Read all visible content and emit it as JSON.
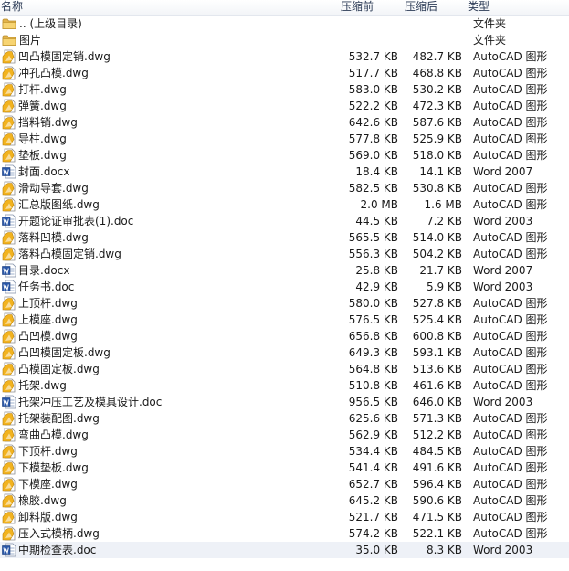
{
  "columns": {
    "name": "名称",
    "compressed": "压缩前",
    "original": "压缩后",
    "type": "类型"
  },
  "rows": [
    {
      "name": ".. (上级目录)",
      "compressed": "",
      "original": "",
      "type": "文件夹",
      "icon": "folder-icon"
    },
    {
      "name": "图片",
      "compressed": "",
      "original": "",
      "type": "文件夹",
      "icon": "folder-icon"
    },
    {
      "name": "凹凸模固定销.dwg",
      "compressed": "532.7 KB",
      "original": "482.7 KB",
      "type": "AutoCAD 图形",
      "icon": "dwg-file-icon"
    },
    {
      "name": "冲孔凸模.dwg",
      "compressed": "517.7 KB",
      "original": "468.8 KB",
      "type": "AutoCAD 图形",
      "icon": "dwg-file-icon"
    },
    {
      "name": "打杆.dwg",
      "compressed": "583.0 KB",
      "original": "530.2 KB",
      "type": "AutoCAD 图形",
      "icon": "dwg-file-icon"
    },
    {
      "name": "弹簧.dwg",
      "compressed": "522.2 KB",
      "original": "472.3 KB",
      "type": "AutoCAD 图形",
      "icon": "dwg-file-icon"
    },
    {
      "name": "挡料销.dwg",
      "compressed": "642.6 KB",
      "original": "587.6 KB",
      "type": "AutoCAD 图形",
      "icon": "dwg-file-icon"
    },
    {
      "name": "导柱.dwg",
      "compressed": "577.8 KB",
      "original": "525.9 KB",
      "type": "AutoCAD 图形",
      "icon": "dwg-file-icon"
    },
    {
      "name": "垫板.dwg",
      "compressed": "569.0 KB",
      "original": "518.0 KB",
      "type": "AutoCAD 图形",
      "icon": "dwg-file-icon"
    },
    {
      "name": "封面.docx",
      "compressed": "18.4 KB",
      "original": "14.1 KB",
      "type": "Word 2007",
      "icon": "word-file-icon"
    },
    {
      "name": "滑动导套.dwg",
      "compressed": "582.5 KB",
      "original": "530.8 KB",
      "type": "AutoCAD 图形",
      "icon": "dwg-file-icon"
    },
    {
      "name": "汇总版图纸.dwg",
      "compressed": "2.0 MB",
      "original": "1.6 MB",
      "type": "AutoCAD 图形",
      "icon": "dwg-file-icon"
    },
    {
      "name": "开题论证审批表(1).doc",
      "compressed": "44.5 KB",
      "original": "7.2 KB",
      "type": "Word 2003",
      "icon": "word-file-icon"
    },
    {
      "name": "落料凹模.dwg",
      "compressed": "565.5 KB",
      "original": "514.0 KB",
      "type": "AutoCAD 图形",
      "icon": "dwg-file-icon"
    },
    {
      "name": "落料凸模固定销.dwg",
      "compressed": "556.3 KB",
      "original": "504.2 KB",
      "type": "AutoCAD 图形",
      "icon": "dwg-file-icon"
    },
    {
      "name": "目录.docx",
      "compressed": "25.8 KB",
      "original": "21.7 KB",
      "type": "Word 2007",
      "icon": "word-file-icon"
    },
    {
      "name": "任务书.doc",
      "compressed": "42.9 KB",
      "original": "5.9 KB",
      "type": "Word 2003",
      "icon": "word-file-icon"
    },
    {
      "name": "上顶杆.dwg",
      "compressed": "580.0 KB",
      "original": "527.8 KB",
      "type": "AutoCAD 图形",
      "icon": "dwg-file-icon"
    },
    {
      "name": "上模座.dwg",
      "compressed": "576.5 KB",
      "original": "525.4 KB",
      "type": "AutoCAD 图形",
      "icon": "dwg-file-icon"
    },
    {
      "name": "凸凹模.dwg",
      "compressed": "656.8 KB",
      "original": "600.8 KB",
      "type": "AutoCAD 图形",
      "icon": "dwg-file-icon"
    },
    {
      "name": "凸凹模固定板.dwg",
      "compressed": "649.3 KB",
      "original": "593.1 KB",
      "type": "AutoCAD 图形",
      "icon": "dwg-file-icon"
    },
    {
      "name": "凸模固定板.dwg",
      "compressed": "564.8 KB",
      "original": "513.6 KB",
      "type": "AutoCAD 图形",
      "icon": "dwg-file-icon"
    },
    {
      "name": "托架.dwg",
      "compressed": "510.8 KB",
      "original": "461.6 KB",
      "type": "AutoCAD 图形",
      "icon": "dwg-file-icon"
    },
    {
      "name": "托架冲压工艺及模具设计.doc",
      "compressed": "956.5 KB",
      "original": "646.0 KB",
      "type": "Word 2003",
      "icon": "word-file-icon"
    },
    {
      "name": "托架装配图.dwg",
      "compressed": "625.6 KB",
      "original": "571.3 KB",
      "type": "AutoCAD 图形",
      "icon": "dwg-file-icon"
    },
    {
      "name": "弯曲凸模.dwg",
      "compressed": "562.9 KB",
      "original": "512.2 KB",
      "type": "AutoCAD 图形",
      "icon": "dwg-file-icon"
    },
    {
      "name": "下顶杆.dwg",
      "compressed": "534.4 KB",
      "original": "484.5 KB",
      "type": "AutoCAD 图形",
      "icon": "dwg-file-icon"
    },
    {
      "name": "下模垫板.dwg",
      "compressed": "541.4 KB",
      "original": "491.6 KB",
      "type": "AutoCAD 图形",
      "icon": "dwg-file-icon"
    },
    {
      "name": "下模座.dwg",
      "compressed": "652.7 KB",
      "original": "596.4 KB",
      "type": "AutoCAD 图形",
      "icon": "dwg-file-icon"
    },
    {
      "name": "橡胶.dwg",
      "compressed": "645.2 KB",
      "original": "590.6 KB",
      "type": "AutoCAD 图形",
      "icon": "dwg-file-icon"
    },
    {
      "name": "卸料版.dwg",
      "compressed": "521.7 KB",
      "original": "471.5 KB",
      "type": "AutoCAD 图形",
      "icon": "dwg-file-icon"
    },
    {
      "name": "压入式模柄.dwg",
      "compressed": "574.2 KB",
      "original": "522.1 KB",
      "type": "AutoCAD 图形",
      "icon": "dwg-file-icon"
    },
    {
      "name": "中期检查表.doc",
      "compressed": "35.0 KB",
      "original": "8.3 KB",
      "type": "Word 2003",
      "icon": "word-file-icon",
      "selected": true
    }
  ]
}
